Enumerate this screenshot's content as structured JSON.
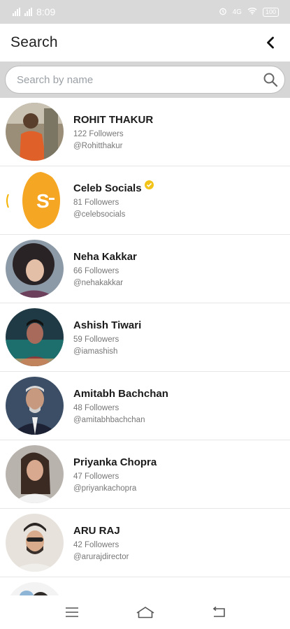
{
  "status_bar": {
    "time": "8:09",
    "battery": "100",
    "network": "4G"
  },
  "header": {
    "title": "Search"
  },
  "search": {
    "placeholder": "Search by name",
    "value": ""
  },
  "users": [
    {
      "name": "ROHIT THAKUR",
      "followers": "122 Followers",
      "handle": "@Rohitthakur",
      "verified": false
    },
    {
      "name": "Celeb Socials",
      "followers": "81 Followers",
      "handle": "@celebsocials",
      "verified": true
    },
    {
      "name": "Neha Kakkar",
      "followers": "66 Followers",
      "handle": "@nehakakkar",
      "verified": false
    },
    {
      "name": "Ashish Tiwari",
      "followers": "59 Followers",
      "handle": "@iamashish",
      "verified": false
    },
    {
      "name": "Amitabh Bachchan",
      "followers": "48 Followers",
      "handle": "@amitabhbachchan",
      "verified": false
    },
    {
      "name": "Priyanka Chopra",
      "followers": "47 Followers",
      "handle": "@priyankachopra",
      "verified": false
    },
    {
      "name": "ARU RAJ",
      "followers": "42 Followers",
      "handle": "@arurajdirector",
      "verified": false
    }
  ],
  "icons": {
    "back": "chevron-left-icon",
    "search": "search-icon",
    "menu": "menu-icon",
    "home": "home-icon",
    "back_nav": "back-nav-icon",
    "verified": "verified-badge-icon"
  },
  "colors": {
    "verified": "#f2c318",
    "header_bg": "#ffffff",
    "search_strip": "#d6d6d6"
  }
}
